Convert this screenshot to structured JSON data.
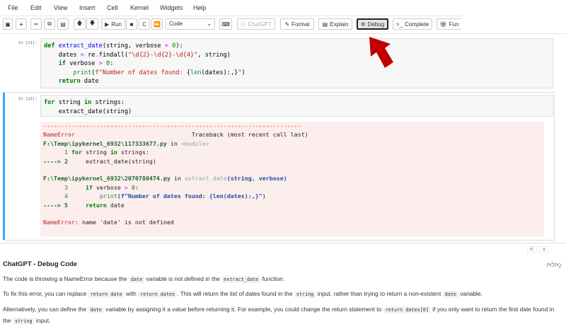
{
  "menu": [
    "File",
    "Edit",
    "View",
    "Insert",
    "Cell",
    "Kernel",
    "Widgets",
    "Help"
  ],
  "toolbar": {
    "run": "Run",
    "cell_type": "Code",
    "chatgpt": "ChatGPT",
    "format": "Format",
    "explain": "Explain",
    "debug": "Debug",
    "complete": "Complete",
    "fun": "Fun"
  },
  "cells": [
    {
      "prompt": "In [21]:",
      "lines": [
        [
          [
            "def",
            "k"
          ],
          [
            " "
          ],
          [
            "extract_date",
            "f"
          ],
          [
            "(string, verbose "
          ],
          [
            "=",
            "o"
          ],
          [
            " "
          ],
          [
            "0",
            "n"
          ],
          [
            "):"
          ]
        ],
        [
          [
            "    dates "
          ],
          [
            "=",
            "o"
          ],
          [
            " re"
          ],
          [
            ".",
            "o"
          ],
          [
            "findall("
          ],
          [
            "\"\\d{2}-\\d{2}-\\d{4}\"",
            "s"
          ],
          [
            ", string)"
          ]
        ],
        [
          [
            "    "
          ],
          [
            "if",
            "k"
          ],
          [
            " verbose "
          ],
          [
            ">",
            "o"
          ],
          [
            " "
          ],
          [
            "0",
            "n"
          ],
          [
            ":"
          ]
        ],
        [
          [
            "        "
          ],
          [
            "print",
            "gr"
          ],
          [
            "("
          ],
          [
            "f\"Number of dates found: ",
            "s"
          ],
          [
            "{"
          ],
          [
            "len",
            "gr"
          ],
          [
            "(dates):,}"
          ],
          [
            "\"",
            "s"
          ],
          [
            ")"
          ]
        ],
        [
          [
            "    "
          ],
          [
            "return",
            "k"
          ],
          [
            " date"
          ]
        ]
      ]
    },
    {
      "prompt": "In [22]:",
      "lines": [
        [
          [
            "for",
            "k"
          ],
          [
            " string "
          ],
          [
            "in",
            "k"
          ],
          [
            " strings:"
          ]
        ],
        [
          [
            "    extract_date(string)"
          ]
        ]
      ]
    }
  ],
  "output": [
    [
      [
        "-------------------------------------------------------------------------",
        "er"
      ]
    ],
    [
      [
        "NameError",
        "er"
      ],
      [
        "                                 Traceback (most recent call last)"
      ]
    ],
    [
      [
        "F:\\Temp\\ipykernel_6932\\117333677.py",
        "gn"
      ],
      [
        " in "
      ],
      [
        "<module>",
        "gy"
      ]
    ],
    [
      [
        "      1 ",
        "gr"
      ],
      [
        "for",
        "k"
      ],
      [
        " string "
      ],
      [
        "in",
        "k"
      ],
      [
        " strings:"
      ]
    ],
    [
      [
        "----> 2",
        "gn"
      ],
      [
        "     extract_date(string)"
      ]
    ],
    [
      [
        ""
      ]
    ],
    [
      [
        "F:\\Temp\\ipykernel_6932\\2070780474.py",
        "gn"
      ],
      [
        " in "
      ],
      [
        "extract_date",
        "gy"
      ],
      [
        "(string, verbose)",
        "bl"
      ]
    ],
    [
      [
        "      3",
        "gr"
      ],
      [
        "     "
      ],
      [
        "if",
        "k"
      ],
      [
        " verbose "
      ],
      [
        ">",
        "o"
      ],
      [
        " "
      ],
      [
        "0",
        "n"
      ],
      [
        ":"
      ]
    ],
    [
      [
        "      4",
        "gr"
      ],
      [
        "         "
      ],
      [
        "print",
        "gr"
      ],
      [
        "(f\"Number of dates found: {len(dates):,}\"",
        "bl"
      ],
      [
        ")"
      ]
    ],
    [
      [
        "----> 5",
        "gn"
      ],
      [
        "     "
      ],
      [
        "return",
        "k"
      ],
      [
        " date"
      ]
    ],
    [
      [
        ""
      ]
    ],
    [
      [
        "NameError",
        "er"
      ],
      [
        ": name 'date' is not defined"
      ]
    ]
  ],
  "panel": {
    "title": "ChatGPT - Debug Code",
    "paragraphs": [
      [
        [
          "The code is throwing a NameError because the "
        ],
        [
          "date",
          "c"
        ],
        [
          " variable is not defined in the "
        ],
        [
          "extract_date",
          "c"
        ],
        [
          " function."
        ]
      ],
      [
        [
          "To fix this error, you can replace "
        ],
        [
          "return date",
          "c"
        ],
        [
          " with "
        ],
        [
          "return dates",
          "c"
        ],
        [
          ". This will return the list of dates found in the "
        ],
        [
          "string",
          "c"
        ],
        [
          " input, rather than trying to return a non-existent "
        ],
        [
          "date",
          "c"
        ],
        [
          " variable."
        ]
      ],
      [
        [
          "Alternatively, you can define the "
        ],
        [
          "date",
          "c"
        ],
        [
          " variable by assigning it a value before returning it. For example, you could change the return statement to "
        ],
        [
          "return dates[0]",
          "c"
        ],
        [
          " if you only want to return the first date found in the "
        ],
        [
          "string",
          "c"
        ],
        [
          " input."
        ]
      ]
    ]
  },
  "colors": {
    "accent": "#42a5f5",
    "error_bg": "#fdeeee",
    "arrow": "#c00000"
  }
}
